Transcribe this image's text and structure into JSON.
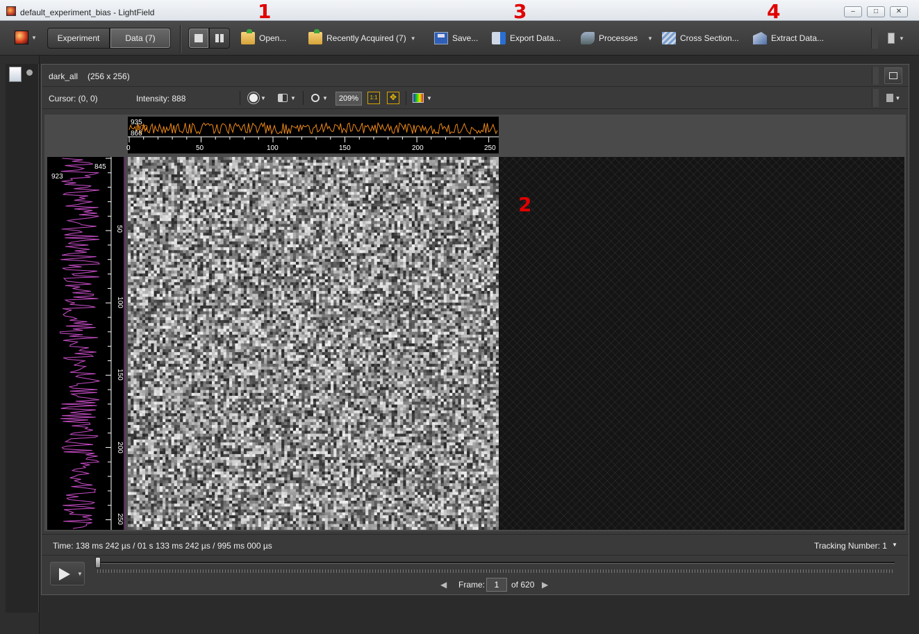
{
  "window": {
    "title": "default_experiment_bias - LightField",
    "minimize": "–",
    "maximize": "□",
    "close": "✕"
  },
  "annotations": [
    "1",
    "2",
    "3",
    "4"
  ],
  "toolbar": {
    "experiment_tab": "Experiment",
    "data_tab": "Data (7)",
    "open": "Open...",
    "recently_acquired": "Recently Acquired (7)",
    "save": "Save...",
    "export_data": "Export Data...",
    "processes": "Processes",
    "cross_section": "Cross Section...",
    "extract_data": "Extract Data..."
  },
  "viewer": {
    "name": "dark_all",
    "dimensions": "(256 x 256)",
    "cursor": "Cursor: (0, 0)",
    "intensity": "Intensity: 888",
    "zoom": "209%",
    "one_to_one": "1:1"
  },
  "horizontal_profile": {
    "labels": [
      "935",
      "900",
      "866"
    ],
    "ticks": [
      "0",
      "50",
      "100",
      "150",
      "200",
      "250"
    ],
    "color": "#f08a18"
  },
  "vertical_profile": {
    "labels": [
      "845",
      "923"
    ],
    "ticks": [
      "50",
      "100",
      "150",
      "200",
      "250"
    ],
    "color": "#c94dc9"
  },
  "footer": {
    "time": "Time: 138 ms 242 µs  /  01 s 133 ms 242 µs  /  995 ms 000 µs",
    "tracking": "Tracking Number: 1",
    "frame_label": "Frame:",
    "frame_value": "1",
    "frame_total": "of 620"
  },
  "icons": {
    "app": "lightfield-app-icon",
    "open": "folder-open-icon",
    "save": "floppy-save-icon",
    "export": "export-icon",
    "processes": "processes-icon",
    "cross_section": "cross-section-icon",
    "extract": "extract-data-icon"
  }
}
